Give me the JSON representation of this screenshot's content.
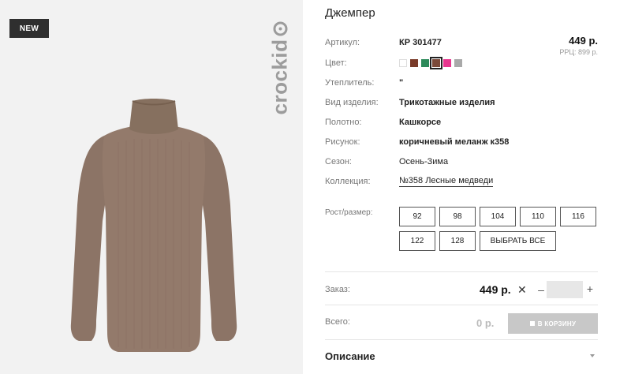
{
  "image": {
    "badge": "NEW",
    "brand_logo_text": "crockid",
    "photo_icon": "turtleneck-sweater-image"
  },
  "product": {
    "title": "Джемпер",
    "price": "449 р.",
    "rrp": "РРЦ: 899 р.",
    "attributes": {
      "article_label": "Артикул:",
      "article_value": "КР 301477",
      "color_label": "Цвет:",
      "insulation_label": "Утеплитель:",
      "insulation_value": "\"",
      "type_label": "Вид изделия:",
      "type_value": "Трикотажные изделия",
      "fabric_label": "Полотно:",
      "fabric_value": "Кашкорсе",
      "pattern_label": "Рисунок:",
      "pattern_value": "коричневый меланж к358",
      "season_label": "Сезон:",
      "season_value": "Осень-Зима",
      "collection_label": "Коллекция:",
      "collection_value": "№358 Лесные медведи"
    },
    "colors": [
      {
        "hex": "#ffffff",
        "selected": false
      },
      {
        "hex": "#7a3b2a",
        "selected": false
      },
      {
        "hex": "#2d8a5a",
        "selected": false
      },
      {
        "hex": "#7b4a3a",
        "selected": true
      },
      {
        "hex": "#e8368f",
        "selected": false
      },
      {
        "hex": "#a9a9a9",
        "selected": false
      }
    ]
  },
  "sizes": {
    "label": "Рост/размер:",
    "options": [
      "92",
      "98",
      "104",
      "110",
      "116",
      "122",
      "128"
    ],
    "select_all": "ВЫБРАТЬ ВСЕ"
  },
  "order": {
    "label": "Заказ:",
    "price": "449 р.",
    "times": "✕",
    "minus": "–",
    "plus": "+",
    "qty": ""
  },
  "total": {
    "label": "Всего:",
    "value": "0 р.",
    "cart_button": "В КОРЗИНУ",
    "cart_icon": "cart-icon"
  },
  "description": {
    "title": "Описание",
    "chevron_icon": "chevron-down-icon"
  }
}
